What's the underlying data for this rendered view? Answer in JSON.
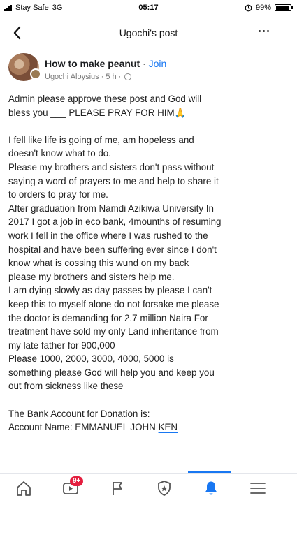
{
  "status_bar": {
    "carrier": "Stay Safe",
    "network": "3G",
    "time": "05:17",
    "battery": "99%"
  },
  "navbar": {
    "title": "Ugochi's post",
    "back_icon": "chevron-left-icon",
    "more_icon": "ellipsis-icon"
  },
  "post": {
    "group_name": "How to make peanut",
    "separator": " · ",
    "join_label": "Join",
    "author": "Ugochi Aloysius",
    "time_ago": "5 h",
    "privacy_icon": "globe-icon",
    "body_lines": [
      "Admin please approve these post and God will",
      "bless you ___ PLEASE PRAY FOR HIM🙏",
      "",
      "I fell like life is going of me, am hopeless and",
      "doesn't know what to do.",
      "Please my brothers and sisters don't pass without",
      "saying a word of prayers to me and help to share it",
      "to orders to pray for me.",
      "After graduation from Namdi Azikiwa University  In",
      "2017 I got a job in eco bank, 4mounths of resuming",
      "work I fell in the office where I was rushed to the",
      "hospital and have been suffering ever since I don't",
      "know what is cossing this wund on my back",
      "please my brothers and sisters help me.",
      "I am dying slowly as day passes by please I can't",
      "keep this to myself alone  do not forsake me please",
      "the doctor is demanding for 2.7 million Naira For",
      "treatment have sold my only Land inheritance from",
      "my late father for 900,000",
      "Please 1000, 2000, 3000, 4000, 5000 is",
      "something please God will help you and keep you",
      "out from sickness like these",
      "",
      "The Bank Account for Donation is:"
    ],
    "account_prefix": "Account Name: EMMANUEL JOHN ",
    "account_suffix": "KEN"
  },
  "bottom_nav": {
    "items": [
      {
        "icon": "home-icon"
      },
      {
        "icon": "watch-icon",
        "badge": "9+"
      },
      {
        "icon": "flag-icon"
      },
      {
        "icon": "shield-icon"
      },
      {
        "icon": "bell-icon",
        "active": true
      },
      {
        "icon": "menu-icon"
      }
    ],
    "active_color": "#1877f2",
    "badge_color": "#e41e3f"
  }
}
